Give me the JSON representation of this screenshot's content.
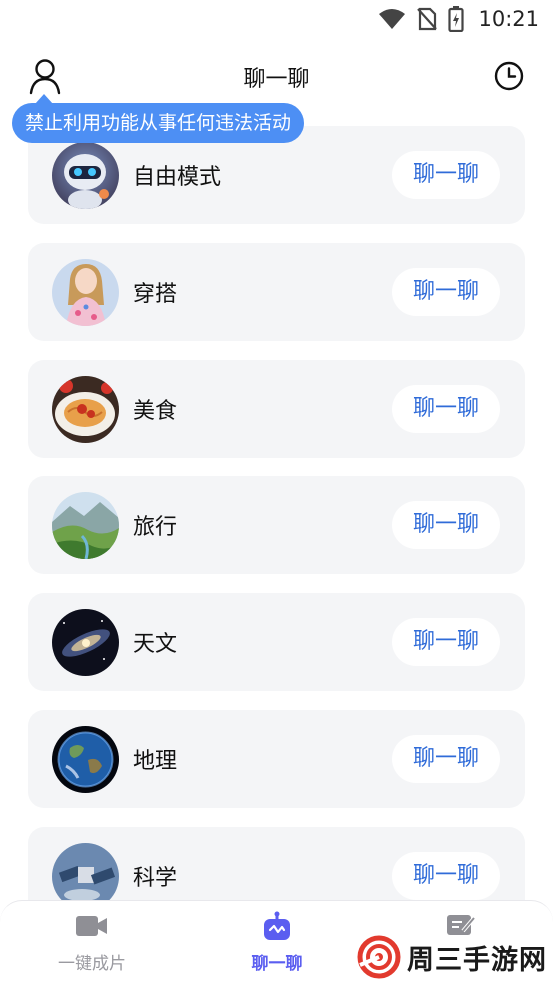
{
  "status_bar": {
    "time": "10:21"
  },
  "header": {
    "title": "聊一聊"
  },
  "notice": {
    "text": "禁止利用功能从事任何违法活动"
  },
  "topics": [
    {
      "label": "自由模式",
      "button": "聊一聊",
      "icon": "robot-avatar"
    },
    {
      "label": "穿搭",
      "button": "聊一聊",
      "icon": "fashion-avatar"
    },
    {
      "label": "美食",
      "button": "聊一聊",
      "icon": "food-avatar"
    },
    {
      "label": "旅行",
      "button": "聊一聊",
      "icon": "travel-avatar"
    },
    {
      "label": "天文",
      "button": "聊一聊",
      "icon": "galaxy-avatar"
    },
    {
      "label": "地理",
      "button": "聊一聊",
      "icon": "earth-avatar"
    },
    {
      "label": "科学",
      "button": "聊一聊",
      "icon": "satellite-avatar"
    }
  ],
  "bottom_nav": [
    {
      "label": "一键成片",
      "icon": "video-icon",
      "active": false
    },
    {
      "label": "聊一聊",
      "icon": "robot-icon",
      "active": true
    },
    {
      "label": "",
      "icon": "note-icon",
      "active": false
    }
  ],
  "watermark": {
    "text": "周三手游网"
  },
  "colors": {
    "accent": "#4d8ff4",
    "button_text": "#2f6bd8",
    "nav_active": "#5b5ef0",
    "card_bg": "#f4f5f7"
  }
}
